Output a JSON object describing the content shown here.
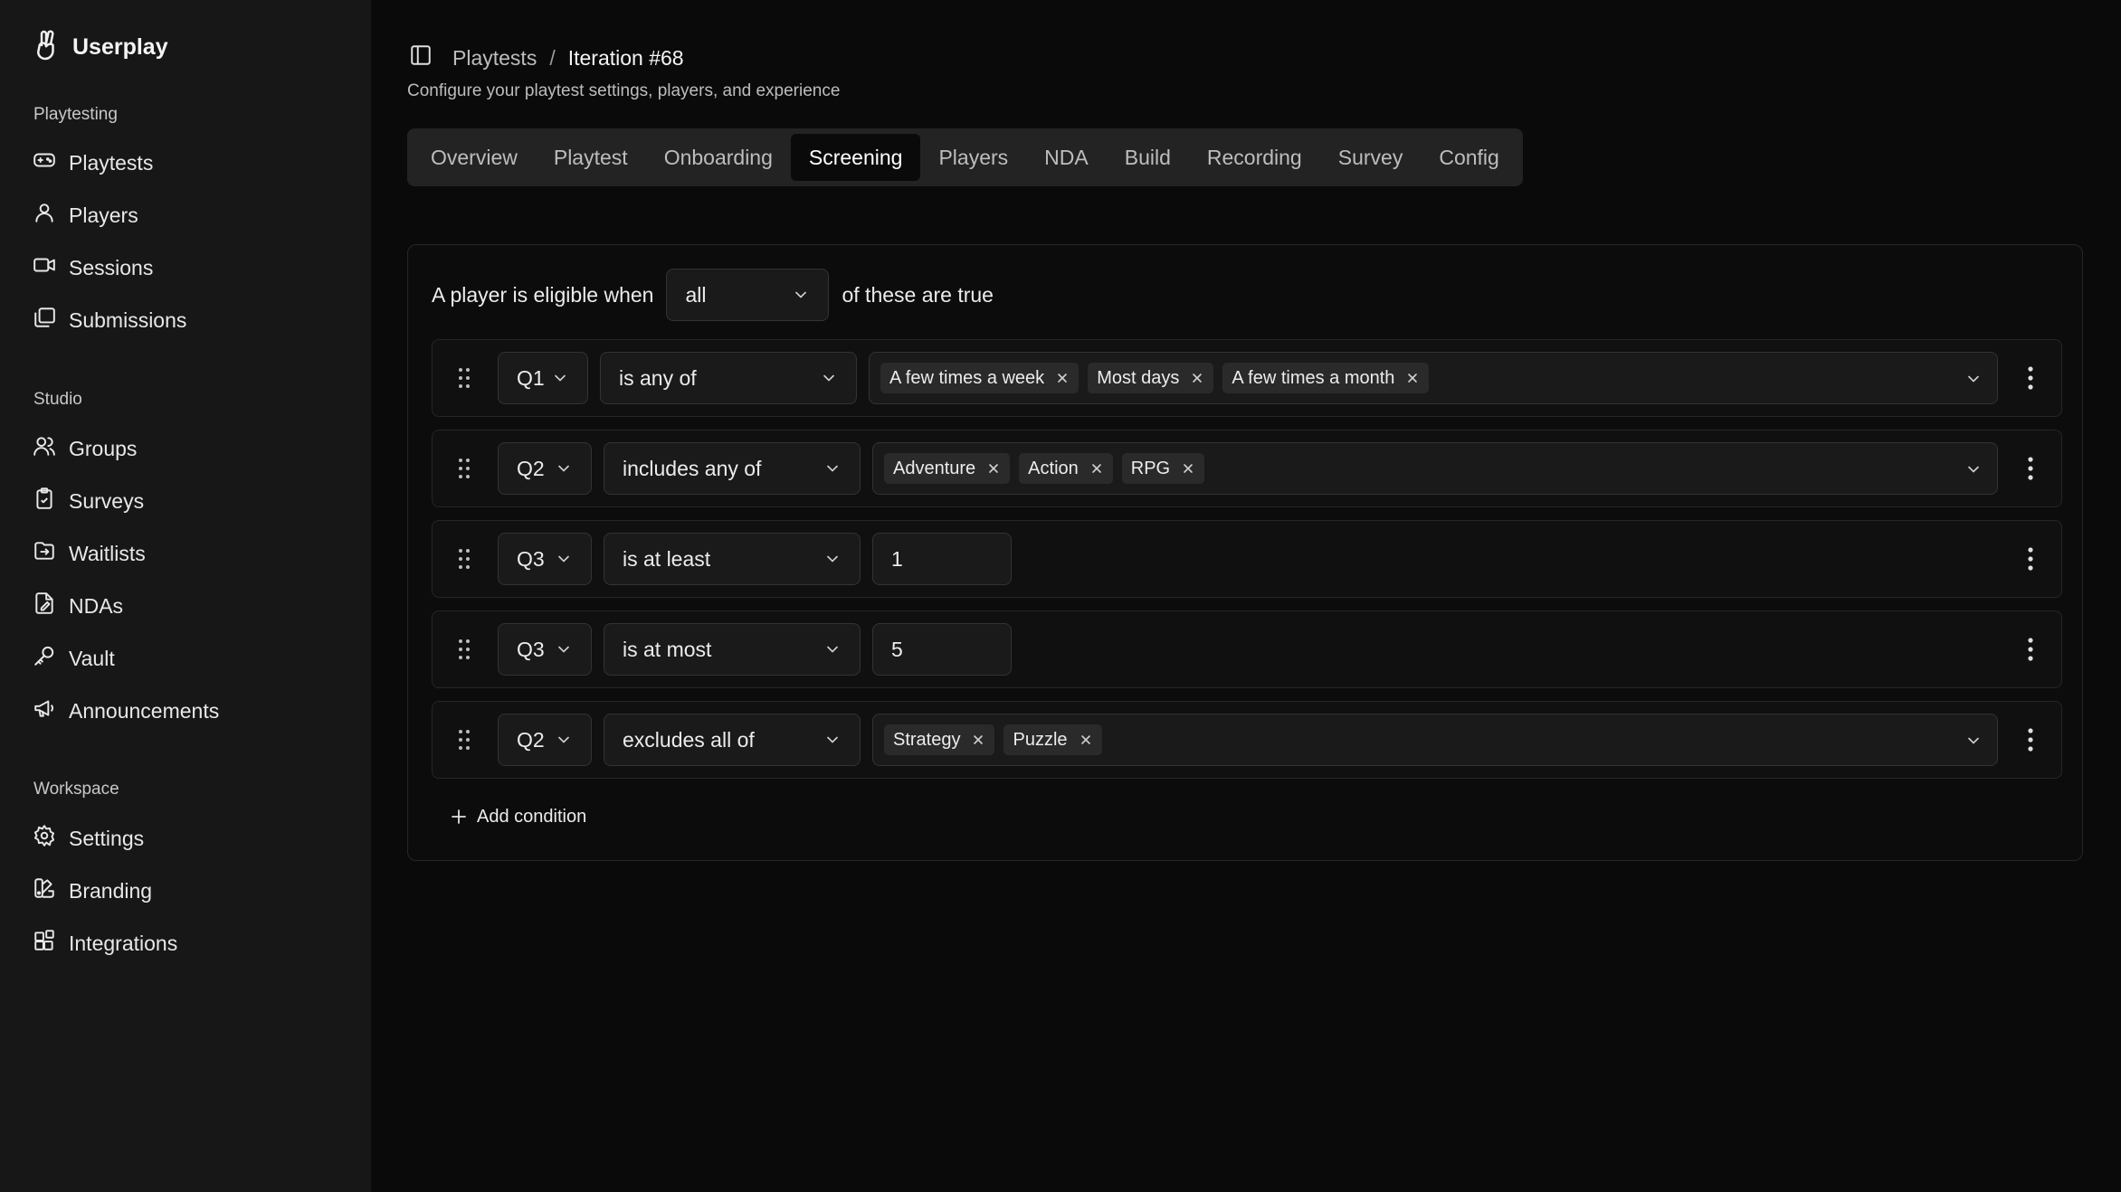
{
  "brand": {
    "name": "Userplay",
    "icon": "hand-peace-icon"
  },
  "sidebar": {
    "sections": [
      {
        "label": "Playtesting",
        "items": [
          {
            "label": "Playtests",
            "icon": "gamepad-icon"
          },
          {
            "label": "Players",
            "icon": "user-icon"
          },
          {
            "label": "Sessions",
            "icon": "video-icon"
          },
          {
            "label": "Submissions",
            "icon": "gallery-icon"
          }
        ]
      },
      {
        "label": "Studio",
        "items": [
          {
            "label": "Groups",
            "icon": "users-icon"
          },
          {
            "label": "Surveys",
            "icon": "clipboard-icon"
          },
          {
            "label": "Waitlists",
            "icon": "folder-input-icon"
          },
          {
            "label": "NDAs",
            "icon": "file-signature-icon"
          },
          {
            "label": "Vault",
            "icon": "key-icon"
          },
          {
            "label": "Announcements",
            "icon": "megaphone-icon"
          }
        ]
      },
      {
        "label": "Workspace",
        "items": [
          {
            "label": "Settings",
            "icon": "gear-icon"
          },
          {
            "label": "Branding",
            "icon": "palette-icon"
          },
          {
            "label": "Integrations",
            "icon": "blocks-icon"
          }
        ]
      }
    ]
  },
  "header": {
    "breadcrumb": {
      "parent": "Playtests",
      "separator": "/",
      "current": "Iteration #68"
    },
    "subtitle": "Configure your playtest settings, players, and experience"
  },
  "tabs": [
    "Overview",
    "Playtest",
    "Onboarding",
    "Screening",
    "Players",
    "NDA",
    "Build",
    "Recording",
    "Survey",
    "Config"
  ],
  "active_tab": "Screening",
  "screening": {
    "prefix": "A player is eligible when",
    "match_value": "all",
    "suffix": "of these are true",
    "conditions": [
      {
        "question": "Q1",
        "operator": "is any of",
        "values": [
          "A few times a week",
          "Most days",
          "A few times a month"
        ]
      },
      {
        "question": "Q2",
        "operator": "includes any of",
        "values": [
          "Adventure",
          "Action",
          "RPG"
        ]
      },
      {
        "question": "Q3",
        "operator": "is at least",
        "number": "1"
      },
      {
        "question": "Q3",
        "operator": "is at most",
        "number": "5"
      },
      {
        "question": "Q2",
        "operator": "excludes all of",
        "values": [
          "Strategy",
          "Puzzle"
        ]
      }
    ],
    "add_label": "Add condition"
  }
}
